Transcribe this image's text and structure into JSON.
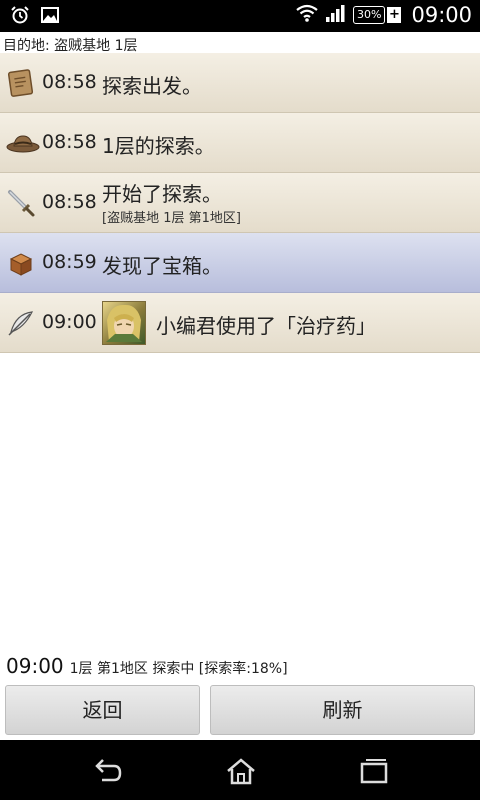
{
  "status_bar": {
    "time": "09:00",
    "battery": "30%",
    "icons": [
      "alarm-icon",
      "image-icon",
      "wifi-icon",
      "signal-icon",
      "battery-icon"
    ]
  },
  "destination": "目的地: 盗贼基地 1层",
  "log": [
    {
      "icon": "map-icon",
      "time": "08:58",
      "text": "探索出发。"
    },
    {
      "icon": "hat-icon",
      "time": "08:58",
      "text": "1层的探索。"
    },
    {
      "icon": "sword-icon",
      "time": "08:58",
      "text": "开始了探索。",
      "sub": "[盗贼基地 1层 第1地区]"
    },
    {
      "icon": "treasure-chest-icon",
      "time": "08:59",
      "text": "发现了宝箱。",
      "highlight": true
    },
    {
      "icon": "feather-icon",
      "time": "09:00",
      "text": "小编君使用了「治疗药」",
      "avatar": "character-avatar"
    }
  ],
  "footer": {
    "time": "09:00",
    "info": "1层 第1地区 探索中 [探索率:18%]"
  },
  "buttons": {
    "back": "返回",
    "refresh": "刷新"
  },
  "nav": {
    "icons": [
      "back-nav-icon",
      "home-nav-icon",
      "recent-apps-icon"
    ]
  }
}
